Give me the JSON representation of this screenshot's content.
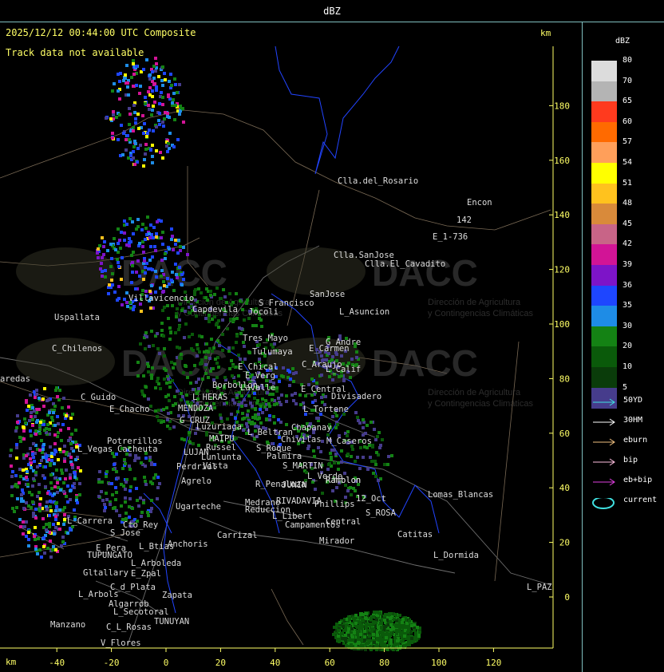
{
  "window": {
    "title": "dBZ"
  },
  "header": {
    "timestamp": "2025/12/12 00:44:00 UTC Composite",
    "track_status": "Track data not available",
    "unit_top": "km",
    "unit_bottom": "km"
  },
  "axes": {
    "x_ticks": [
      "-40",
      "-20",
      "0",
      "20",
      "40",
      "60",
      "80",
      "100",
      "120"
    ],
    "y_ticks": [
      "180",
      "160",
      "140",
      "120",
      "100",
      "80",
      "60",
      "40",
      "20",
      "0"
    ]
  },
  "legend": {
    "title": "dBZ",
    "bins": [
      {
        "label": "80",
        "color": "#dcdcdc"
      },
      {
        "label": "70",
        "color": "#b4b4b4"
      },
      {
        "label": "65",
        "color": "#ff3a1e"
      },
      {
        "label": "60",
        "color": "#ff6a00"
      },
      {
        "label": "57",
        "color": "#ff9f5a"
      },
      {
        "label": "54",
        "color": "#ffff00"
      },
      {
        "label": "51",
        "color": "#ffc21e"
      },
      {
        "label": "48",
        "color": "#d98a3a"
      },
      {
        "label": "45",
        "color": "#c86487"
      },
      {
        "label": "42",
        "color": "#d21496"
      },
      {
        "label": "39",
        "color": "#7d14c8"
      },
      {
        "label": "36",
        "color": "#1e46ff"
      },
      {
        "label": "35",
        "color": "#1e8ce6"
      },
      {
        "label": "30",
        "color": "#148214"
      },
      {
        "label": "20",
        "color": "#0a5a0a"
      },
      {
        "label": "10",
        "color": "#0a3c0a"
      },
      {
        "label": "5",
        "color": "#463c8c"
      }
    ]
  },
  "tracks": [
    {
      "label": "50YD",
      "color": "#40e0e0"
    },
    {
      "label": "30HM",
      "color": "#ffffff"
    },
    {
      "label": "eburn",
      "color": "#f0c080"
    },
    {
      "label": "bip",
      "color": "#ffc0e0"
    },
    {
      "label": "eb+bip",
      "color": "#e040e0"
    },
    {
      "label": "current",
      "color": "#40e0e0"
    }
  ],
  "watermark": {
    "brand": "DACC",
    "line1": "Dirección de Agricultura",
    "line2": "y Contingencias Climáticas"
  },
  "places": [
    "Clla.del_Rosario",
    "Encon",
    "142",
    "E_1-736",
    "Ramblon",
    "Clla.SanJose",
    "Clla.El_Cavadito",
    "Villavicencio",
    "Capdevila",
    "S_Francisco",
    "Jocoli",
    "SanJose",
    "L_Asuncion",
    "Uspallata",
    "Tres_Mayo",
    "Tulumaya",
    "G_Andre",
    "E_Carmen",
    "C_Chilenos",
    "E_Chical",
    "E_Verg",
    "C_Araujo",
    "L_Calif",
    "Borbollon",
    "Lavalle",
    "E_Central",
    "Divisadero",
    "L_HERAS",
    "E_Chacho",
    "MENDOZA",
    "L_Tortene",
    "G_CRUZ",
    "Luzuriaga",
    "L_Beltran",
    "Chapanay",
    "C_Guido",
    "MAIPU",
    "Russel",
    "Chivilas",
    "M_Caseros",
    "Potrerillos",
    "Cacheuta",
    "L_Vegas",
    "LUJAN",
    "Lunlunta",
    "S_Roque",
    "Palmira",
    "Perdriel",
    "S_MARTIN",
    "L_Verde",
    "Agrelo",
    "R_Penaloza",
    "JUNIN",
    "Ramblon",
    "Lomas_Blancas",
    "Ugarteche",
    "Medrano",
    "RIVADAVIA",
    "12_Oct",
    "Reduccion",
    "Phillips",
    "S_ROSA",
    "L_Carrera",
    "Cto_Rey",
    "L_Libert",
    "Campamentos",
    "Central",
    "S_Jose",
    "Catitas",
    "Carrizal",
    "Mirador",
    "Anchoris",
    "E_Pera",
    "TUPUNGATO",
    "L_Btias",
    "L_Dormida",
    "L_Arboleda",
    "Gltallary",
    "E_Zpal",
    "L_PAZ",
    "C_d_Plata",
    "L_Arbols",
    "Zapata",
    "Algarrob",
    "L_Secotoral",
    "TUNUYAN",
    "Manzano",
    "C_L_Rosas",
    "V_Flores",
    "aredas",
    "Vista"
  ]
}
